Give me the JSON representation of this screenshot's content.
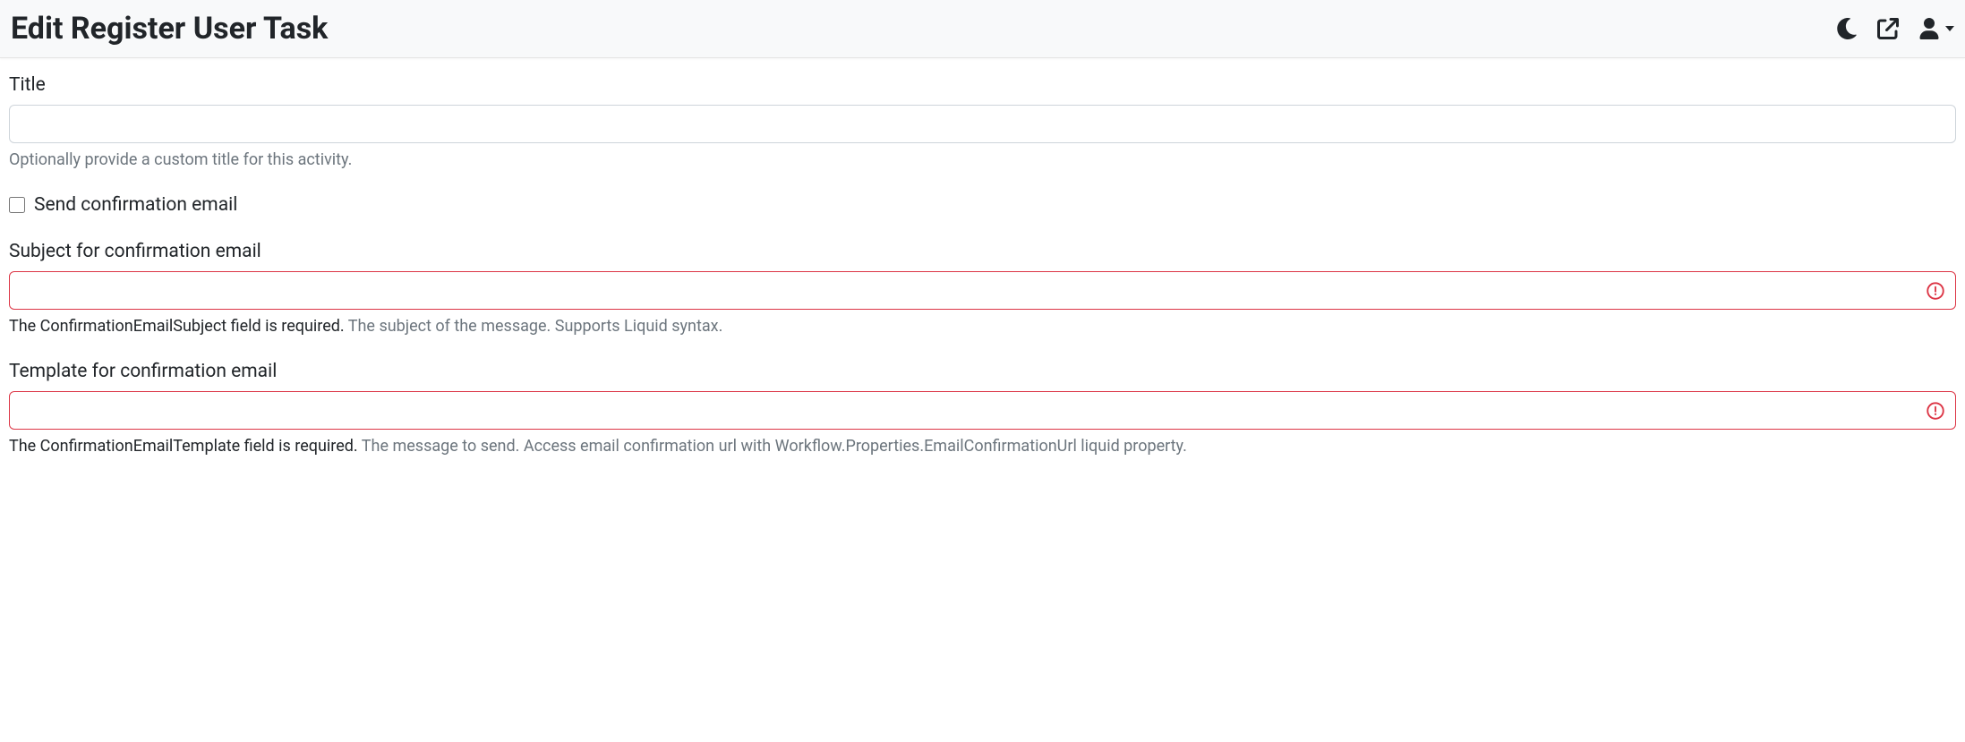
{
  "header": {
    "title": "Edit Register User Task"
  },
  "form": {
    "title": {
      "label": "Title",
      "value": "",
      "hint": "Optionally provide a custom title for this activity."
    },
    "sendConfirmation": {
      "label": "Send confirmation email",
      "checked": false
    },
    "subject": {
      "label": "Subject for confirmation email",
      "value": "",
      "error": "The ConfirmationEmailSubject field is required.",
      "hint": "The subject of the message. Supports Liquid syntax."
    },
    "template": {
      "label": "Template for confirmation email",
      "value": "",
      "error": "The ConfirmationEmailTemplate field is required.",
      "hint": "The message to send. Access email confirmation url with Workflow.Properties.EmailConfirmationUrl liquid property."
    }
  }
}
